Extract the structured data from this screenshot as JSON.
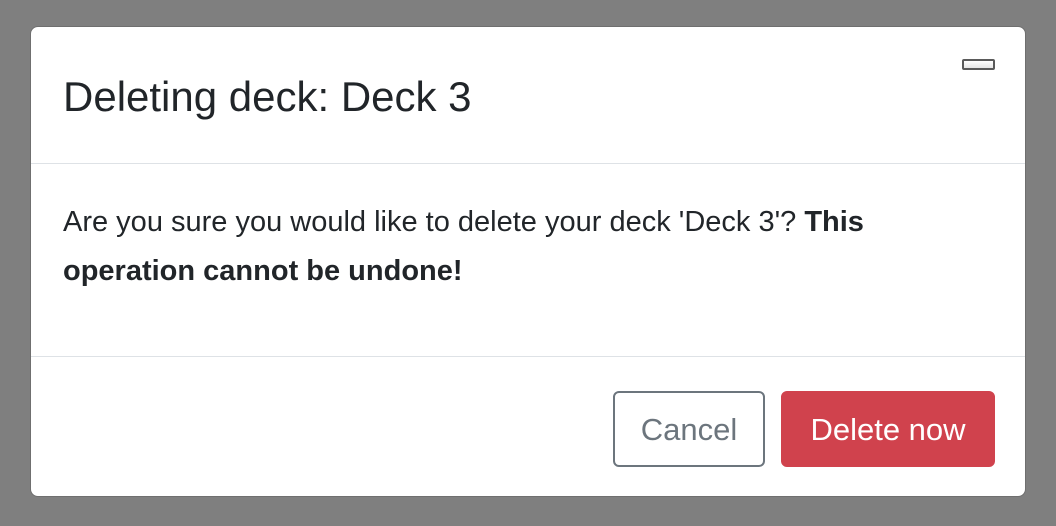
{
  "dialog": {
    "title": "Deleting deck: Deck 3",
    "message": "Are you sure you would like to delete your deck 'Deck 3'? ",
    "warning": "This operation cannot be undone!",
    "close_icon": "close-icon",
    "cancel_label": "Cancel",
    "delete_label": "Delete now"
  },
  "colors": {
    "backdrop": "#7f7f7f",
    "danger": "#d0424d",
    "secondary": "#6c757d",
    "text": "#212529"
  }
}
